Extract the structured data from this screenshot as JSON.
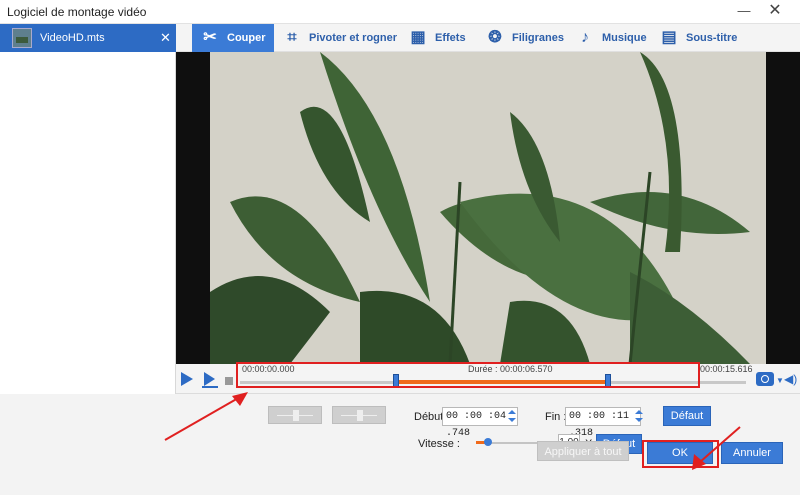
{
  "window": {
    "title": "Logiciel de montage vidéo",
    "minimize": "—",
    "close": "✕"
  },
  "file_list": [
    {
      "name": "VideoHD.mts",
      "remove": "✕"
    }
  ],
  "tabs": [
    {
      "label": "Couper",
      "icon": "scissors-icon",
      "active": true
    },
    {
      "label": "Pivoter et rogner",
      "icon": "crop-icon",
      "active": false
    },
    {
      "label": "Effets",
      "icon": "effects-icon",
      "active": false
    },
    {
      "label": "Filigranes",
      "icon": "watermark-icon",
      "active": false
    },
    {
      "label": "Musique",
      "icon": "music-note-icon",
      "active": false
    },
    {
      "label": "Sous-titre",
      "icon": "subtitle-icon",
      "active": false
    }
  ],
  "timeline": {
    "start_label": "00:00:00.000",
    "duration_label": "Durée : 00:00:06.570",
    "end_label": "00:00:15.616",
    "selection_start_fraction": 0.3,
    "selection_end_fraction": 0.73
  },
  "settings": {
    "debut_label": "Début",
    "debut_value": "00 :00 :04 .748",
    "fin_label": "Fin :",
    "fin_value": "00 :00 :11 .318",
    "defaut1": "Défaut",
    "vitesse_label": "Vitesse :",
    "vitesse_value": "1.00",
    "vitesse_unit": "X",
    "defaut2": "Défaut"
  },
  "buttons": {
    "apply_all": "Appliquer à tout",
    "ok": "OK",
    "cancel": "Annuler"
  },
  "colors": {
    "accent": "#3b7bd6",
    "highlight": "#f06a1a",
    "annotation": "#e02020"
  }
}
